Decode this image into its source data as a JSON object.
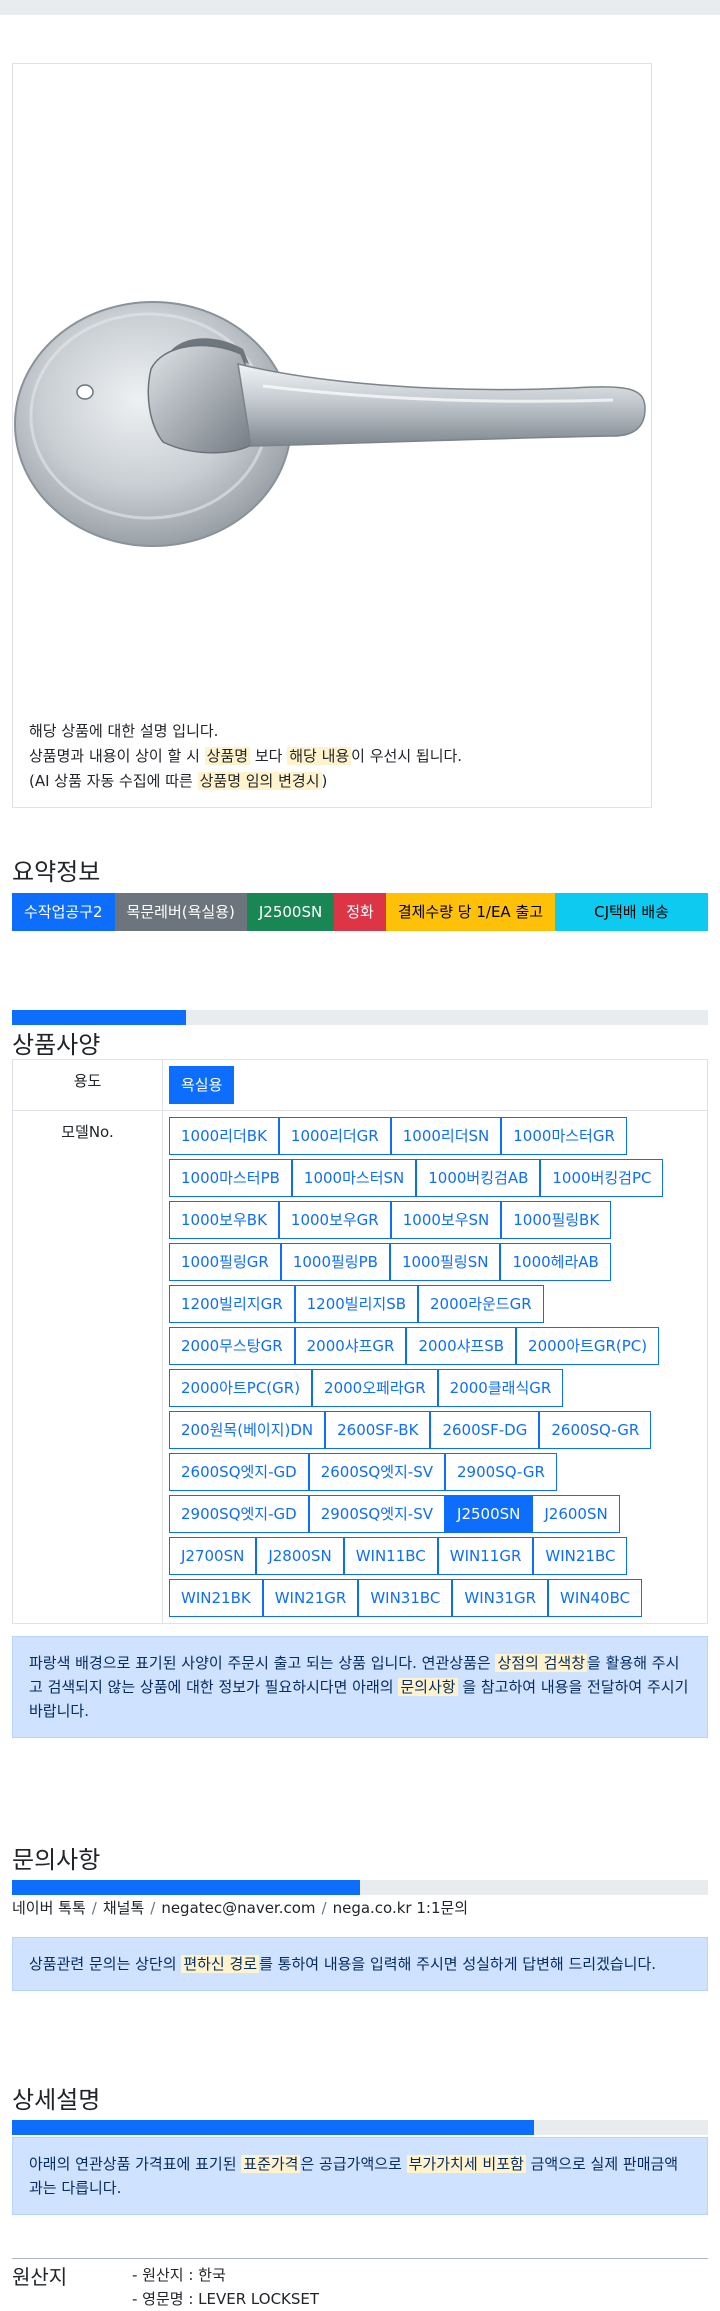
{
  "product_notice": {
    "line1": "해당 상품에 대한 설명 입니다.",
    "line2_a": "상품명과 내용이 상이 할 시 ",
    "line2_hl1": "상품명",
    "line2_b": " 보다 ",
    "line2_hl2": "해당 내용",
    "line2_c": "이 우선시 됩니다.",
    "line3_a": "(AI 상품 자동 수집에 따른 ",
    "line3_hl": "상품명 임의 변경시",
    "line3_b": ")"
  },
  "summary": {
    "title": "요약정보",
    "badges": [
      "수작업공구2",
      "목문레버(욕실용)",
      "J2500SN",
      "정화",
      "결제수량 당 1/EA 출고",
      "CJ택배 배송"
    ]
  },
  "specs": {
    "title": "상품사양",
    "progress": 0.25,
    "usage_label": "용도",
    "usage_options": [
      "욕실용"
    ],
    "model_label": "모델No.",
    "model_rows": [
      [
        "1000리더BK",
        "1000리더GR",
        "1000리더SN",
        "1000마스터GR"
      ],
      [
        "1000마스터PB",
        "1000마스터SN",
        "1000버킹검AB",
        "1000버킹검PC"
      ],
      [
        "1000보우BK",
        "1000보우GR",
        "1000보우SN",
        "1000필링BK"
      ],
      [
        "1000필링GR",
        "1000필링PB",
        "1000필링SN",
        "1000헤라AB"
      ],
      [
        "1200빌리지GR",
        "1200빌리지SB",
        "2000라운드GR"
      ],
      [
        "2000무스탕GR",
        "2000샤프GR",
        "2000샤프SB",
        "2000아트GR(PC)"
      ],
      [
        "2000아트PC(GR)",
        "2000오페라GR",
        "2000클래식GR"
      ],
      [
        "200원목(베이지)DN",
        "2600SF-BK",
        "2600SF-DG",
        "2600SQ-GR"
      ],
      [
        "2600SQ엣지-GD",
        "2600SQ엣지-SV",
        "2900SQ-GR"
      ],
      [
        "2900SQ엣지-GD",
        "2900SQ엣지-SV",
        "J2500SN",
        "J2600SN"
      ],
      [
        "J2700SN",
        "J2800SN",
        "WIN11BC",
        "WIN11GR",
        "WIN21BC"
      ],
      [
        "WIN21BK",
        "WIN21GR",
        "WIN31BC",
        "WIN31GR",
        "WIN40BC"
      ]
    ],
    "selected_model": "J2500SN",
    "notice_a": "파랑색 배경으로 표기된 사양이 주문시 출고 되는 상품 입니다. 연관상품은 ",
    "notice_hl1": "상점의 검색창",
    "notice_b": "을 활용해 주시고 검색되지 않는 상품에 대한 정보가 필요하시다면 아래의 ",
    "notice_hl2": "문의사항",
    "notice_c": " 을 참고하여 내용을 전달하여 주시기 바랍니다."
  },
  "inquiry": {
    "title": "문의사항",
    "progress": 0.5,
    "contacts": [
      "네이버 톡톡",
      "채널톡",
      "negatec@naver.com",
      "nega.co.kr 1:1문의"
    ],
    "separator": "/",
    "notice_a": "상품관련 문의는 상단의 ",
    "notice_hl": "편하신 경로",
    "notice_b": "를 통하여 내용을 입력해 주시면 성실하게 답변해 드리겠습니다."
  },
  "detail": {
    "title": "상세설명",
    "progress": 0.75,
    "notice_a": "아래의 연관상품 가격표에 표기된 ",
    "notice_hl1": "표준가격",
    "notice_b": "은 공급가액으로 ",
    "notice_hl2": "부가가치세 비포함",
    "notice_c": " 금액으로 실제 판매금액과는 다릅니다."
  },
  "origin": {
    "title": "원산지",
    "items": [
      "- 원산지 : 한국",
      "- 영문명 : LEVER LOCKSET"
    ]
  },
  "colors": {
    "primary": "#0d6efd",
    "highlight": "#fff3cd",
    "alert_bg": "#cfe2ff"
  }
}
